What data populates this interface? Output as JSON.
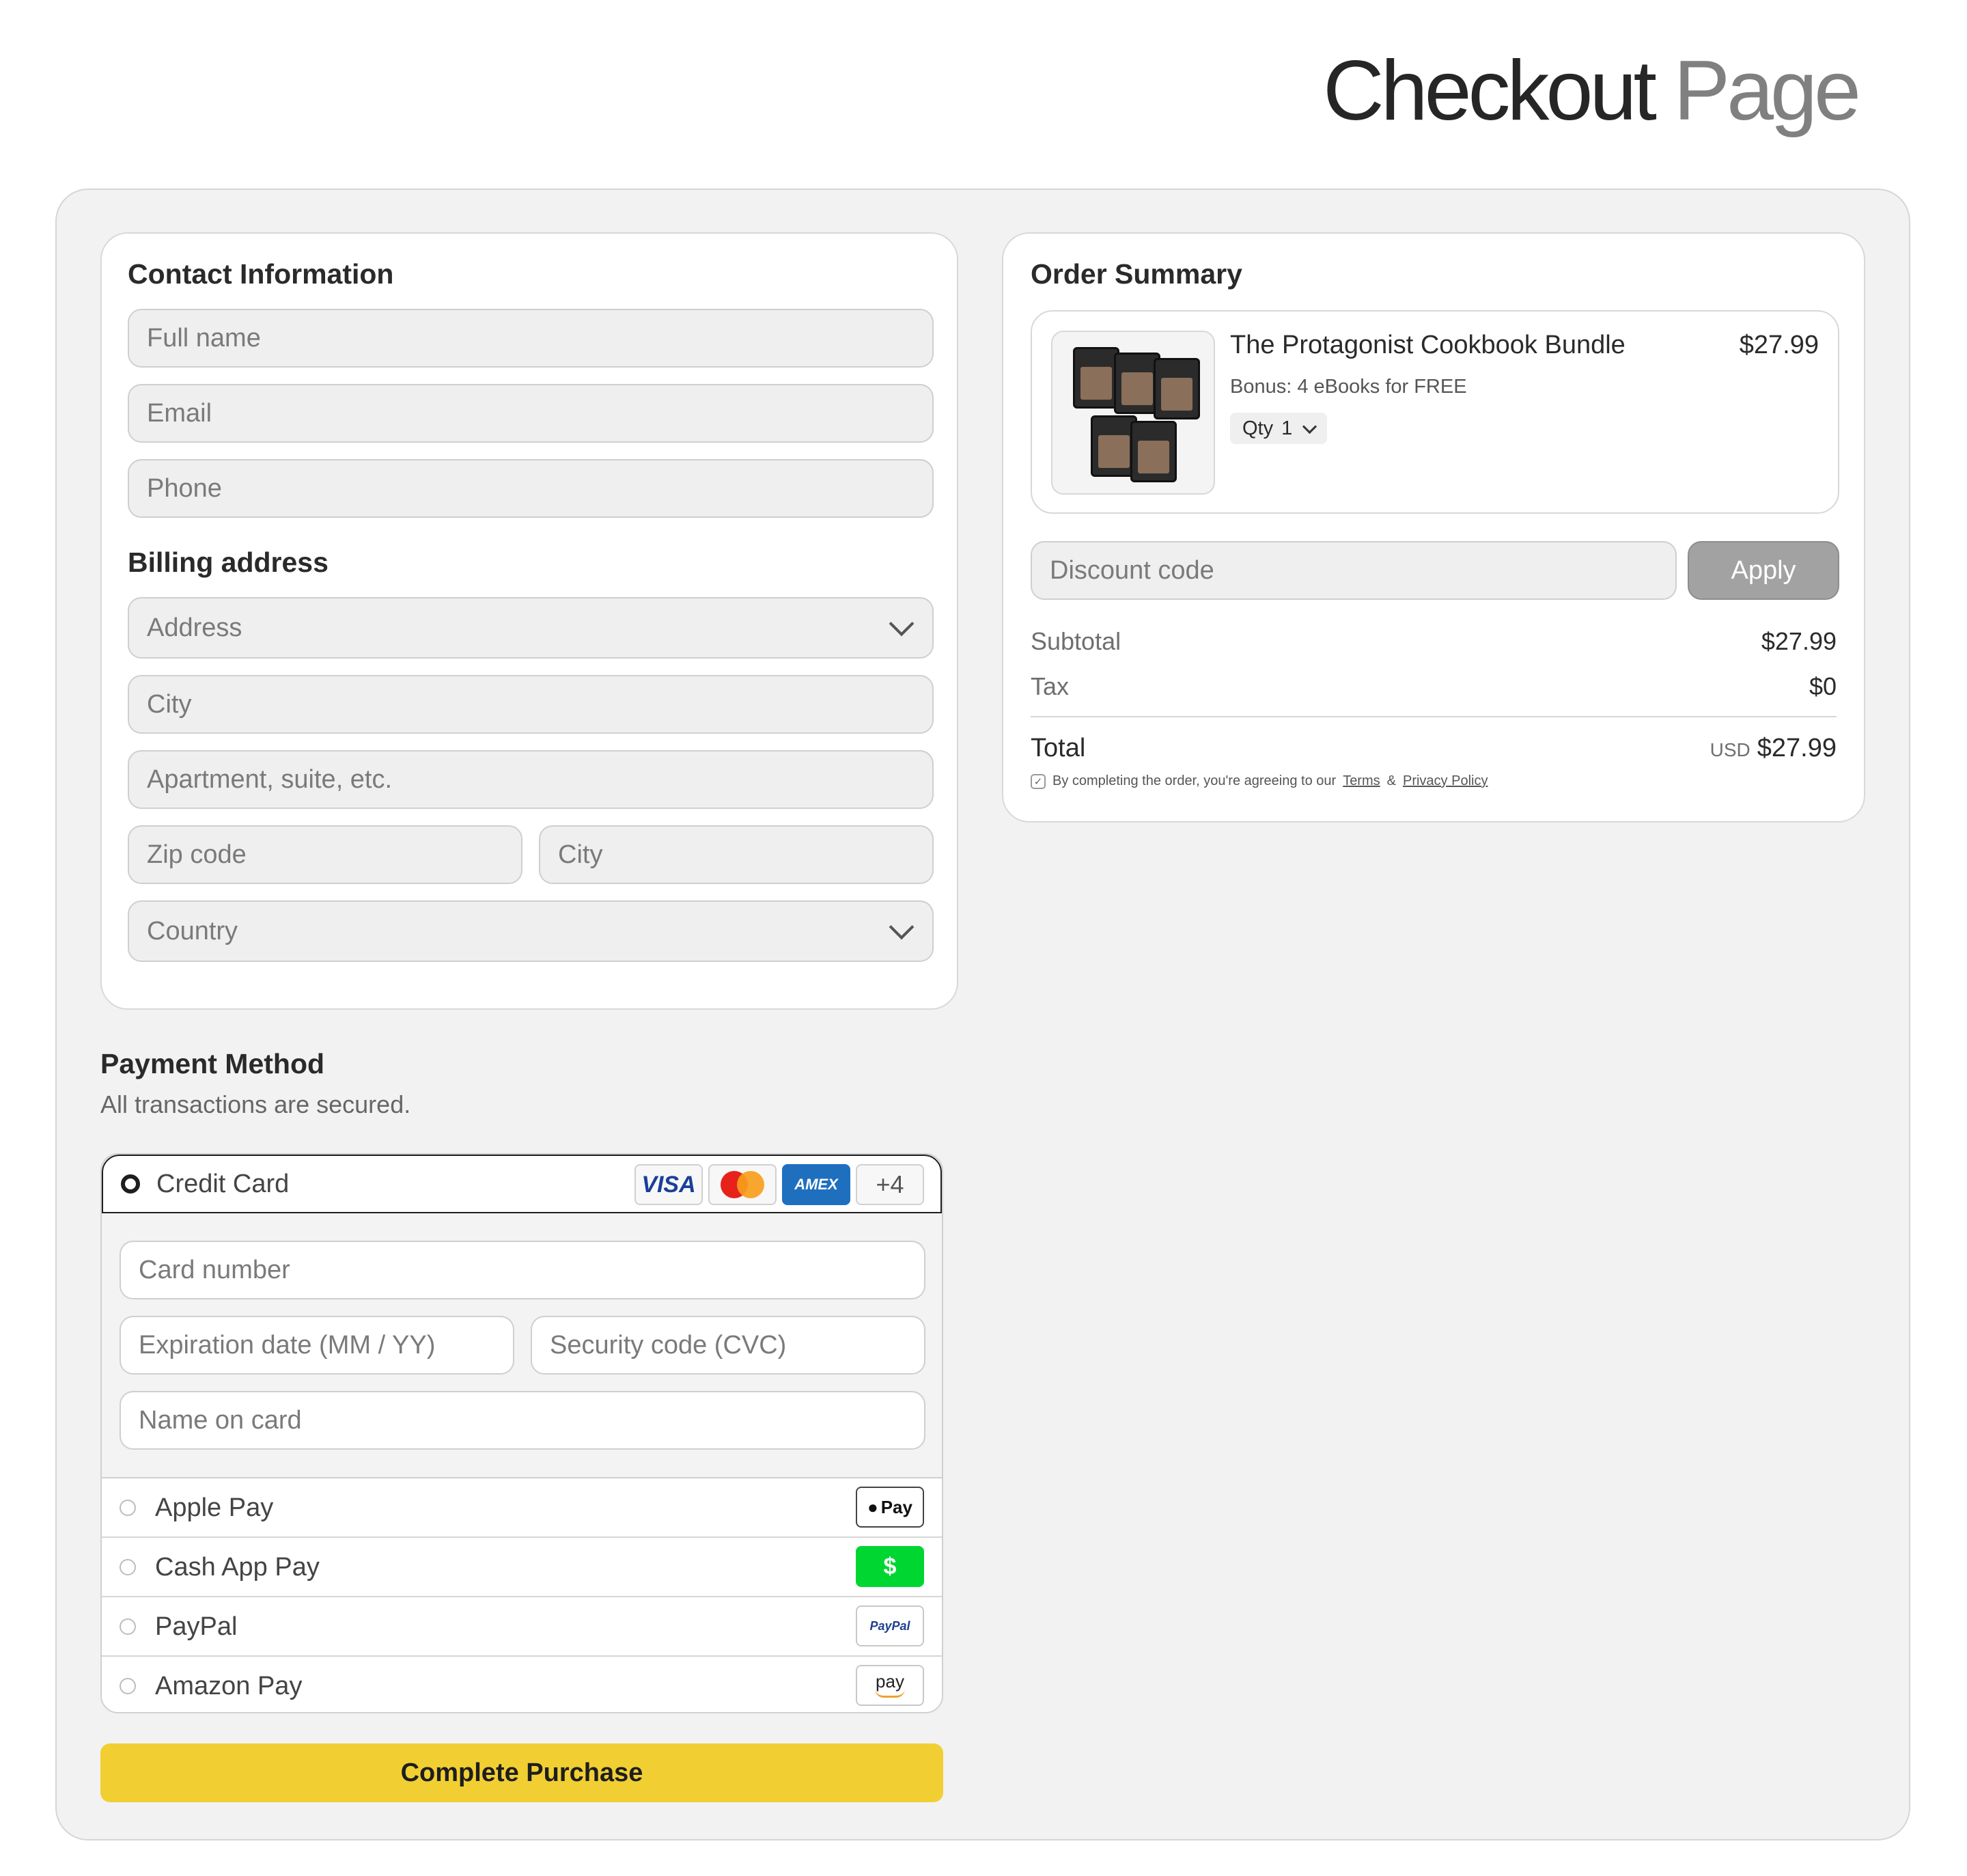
{
  "page_title": {
    "part1": "Checkout",
    "part2": "Page"
  },
  "contact": {
    "title": "Contact Information",
    "full_name_placeholder": "Full name",
    "email_placeholder": "Email",
    "phone_placeholder": "Phone"
  },
  "billing": {
    "title": "Billing address",
    "address_placeholder": "Address",
    "city_placeholder": "City",
    "apartment_placeholder": "Apartment, suite, etc.",
    "zip_placeholder": "Zip code",
    "city2_placeholder": "City",
    "country_placeholder": "Country"
  },
  "order": {
    "title": "Order Summary",
    "product_name": "The Protagonist Cookbook Bundle",
    "product_price": "$27.99",
    "bonus": "Bonus: 4 eBooks for FREE",
    "qty_label": "Qty",
    "qty_value": "1",
    "discount_placeholder": "Discount code",
    "apply_label": "Apply",
    "subtotal_label": "Subtotal",
    "subtotal_value": "$27.99",
    "tax_label": "Tax",
    "tax_value": "$0",
    "total_label": "Total",
    "total_currency": "USD",
    "total_value": "$27.99",
    "terms_prefix": "By completing the order, you're agreeing to our",
    "terms_link": "Terms",
    "terms_amp": "&",
    "privacy_link": "Privacy Policy"
  },
  "payment": {
    "title": "Payment Method",
    "subtitle": "All transactions are secured.",
    "credit_card_label": "Credit Card",
    "brands": {
      "visa": "VISA",
      "amex": "AMEX",
      "more": "+4"
    },
    "card_number_placeholder": "Card number",
    "expiration_placeholder": "Expiration date (MM / YY)",
    "cvc_placeholder": "Security code (CVC)",
    "name_on_card_placeholder": "Name on card",
    "options": [
      {
        "label": "Apple Pay",
        "badge": "Pay"
      },
      {
        "label": "Cash App Pay",
        "badge": "$"
      },
      {
        "label": "PayPal",
        "badge": "PayPal"
      },
      {
        "label": "Amazon Pay",
        "badge": "pay"
      }
    ],
    "cta_label": "Complete Purchase"
  },
  "colors": {
    "accent": "#f1cf33",
    "cash_app": "#00d632",
    "amex": "#1f6fbf"
  }
}
